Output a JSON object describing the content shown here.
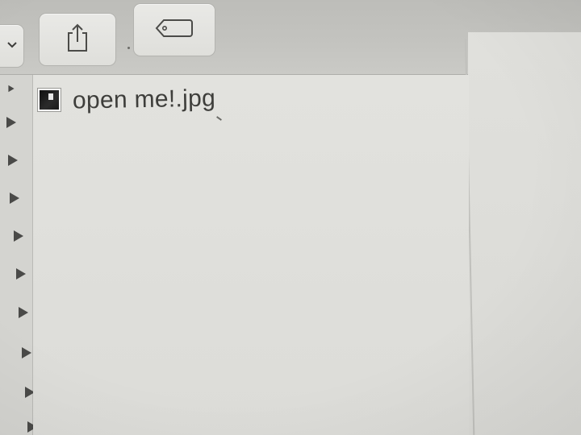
{
  "toolbar": {
    "view_button_icon": "chevron-down-icon",
    "share_button_icon": "share-icon",
    "tags_button_icon": "tag-icon"
  },
  "sidebar": {
    "disclosure_icon": "triangle-right-icon",
    "items": [
      {},
      {},
      {},
      {},
      {},
      {},
      {},
      {},
      {}
    ]
  },
  "file_list": {
    "items": [
      {
        "name": "open me!.jpg",
        "icon": "image-file-icon"
      }
    ]
  },
  "colors": {
    "toolbar_bg": "#c3c3bf",
    "window_bg": "#dcdcd8",
    "text": "#3e3e3b"
  }
}
